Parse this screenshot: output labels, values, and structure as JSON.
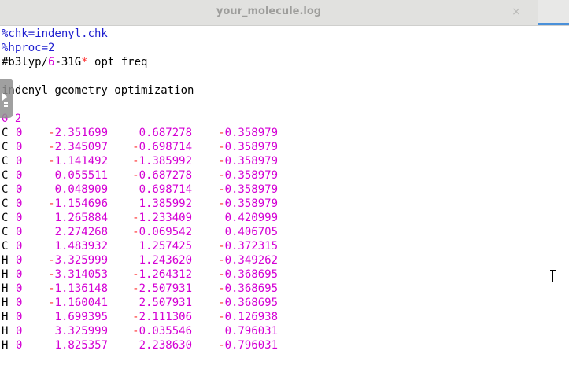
{
  "tab": {
    "title": "your_molecule.log",
    "close_glyph": "×"
  },
  "header_lines": {
    "chk": "%chk=indenyl.chk",
    "nproc_before_caret": "%hpro",
    "nproc_after_caret": "c=2",
    "route_hash": "#b3lyp/",
    "route_6": "6",
    "route_dash31g": "-31G",
    "route_star": "*",
    "route_rest": " opt freq",
    "title": "indenyl geometry optimization",
    "charge_mult": "0 2"
  },
  "atoms": [
    {
      "el": "C",
      "flag": "0",
      "x": "-2.351699",
      "y": "0.687278",
      "z": "-0.358979"
    },
    {
      "el": "C",
      "flag": "0",
      "x": "-2.345097",
      "y": "-0.698714",
      "z": "-0.358979"
    },
    {
      "el": "C",
      "flag": "0",
      "x": "-1.141492",
      "y": "-1.385992",
      "z": "-0.358979"
    },
    {
      "el": "C",
      "flag": "0",
      "x": "0.055511",
      "y": "-0.687278",
      "z": "-0.358979"
    },
    {
      "el": "C",
      "flag": "0",
      "x": "0.048909",
      "y": "0.698714",
      "z": "-0.358979"
    },
    {
      "el": "C",
      "flag": "0",
      "x": "-1.154696",
      "y": "1.385992",
      "z": "-0.358979"
    },
    {
      "el": "C",
      "flag": "0",
      "x": "1.265884",
      "y": "-1.233409",
      "z": "0.420999"
    },
    {
      "el": "C",
      "flag": "0",
      "x": "2.274268",
      "y": "-0.069542",
      "z": "0.406705"
    },
    {
      "el": "C",
      "flag": "0",
      "x": "1.483932",
      "y": "1.257425",
      "z": "-0.372315"
    },
    {
      "el": "H",
      "flag": "0",
      "x": "-3.325999",
      "y": "1.243620",
      "z": "-0.349262"
    },
    {
      "el": "H",
      "flag": "0",
      "x": "-3.314053",
      "y": "-1.264312",
      "z": "-0.368695"
    },
    {
      "el": "H",
      "flag": "0",
      "x": "-1.136148",
      "y": "-2.507931",
      "z": "-0.368695"
    },
    {
      "el": "H",
      "flag": "0",
      "x": "-1.160041",
      "y": "2.507931",
      "z": "-0.368695"
    },
    {
      "el": "H",
      "flag": "0",
      "x": "1.699395",
      "y": "-2.111306",
      "z": "-0.126938"
    },
    {
      "el": "H",
      "flag": "0",
      "x": "3.325999",
      "y": "-0.035546",
      "z": "0.796031"
    },
    {
      "el": "H",
      "flag": "0",
      "x": "1.825357",
      "y": "2.238630",
      "z": "-0.796031"
    }
  ],
  "colors": {
    "keyword_blue": "#1f1fcf",
    "number_magenta": "#d400d4",
    "operator_red": "#ff3030",
    "tab_accent": "#4a90d9"
  }
}
